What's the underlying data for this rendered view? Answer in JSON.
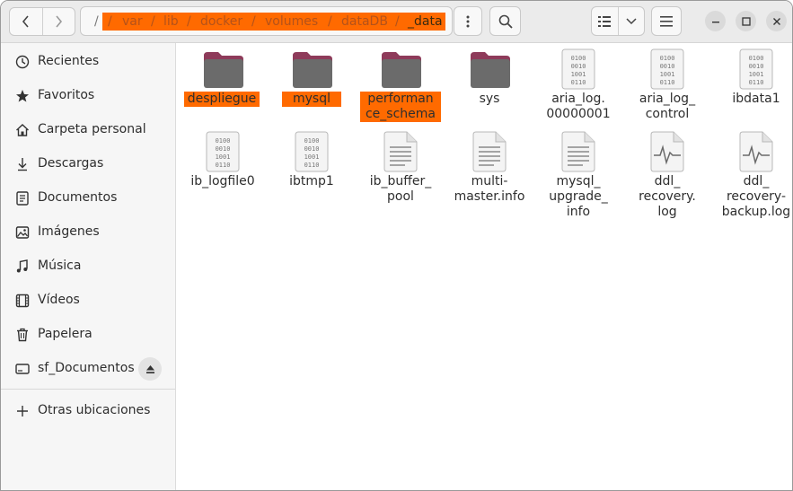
{
  "header": {
    "path_root": "/",
    "path_segments": [
      "/",
      "var",
      "lib",
      "docker",
      "volumes",
      "dataDB",
      "_data"
    ]
  },
  "sidebar": {
    "items": [
      {
        "label": "Recientes",
        "icon": "clock-icon"
      },
      {
        "label": "Favoritos",
        "icon": "star-icon"
      },
      {
        "label": "Carpeta personal",
        "icon": "home-icon"
      },
      {
        "label": "Descargas",
        "icon": "download-icon"
      },
      {
        "label": "Documentos",
        "icon": "document-icon"
      },
      {
        "label": "Imágenes",
        "icon": "image-icon"
      },
      {
        "label": "Música",
        "icon": "music-icon"
      },
      {
        "label": "Vídeos",
        "icon": "video-icon"
      },
      {
        "label": "Papelera",
        "icon": "trash-icon"
      },
      {
        "label": "sf_Documentos",
        "icon": "drive-icon"
      },
      {
        "label": "Otras ubicaciones",
        "icon": "plus-icon"
      }
    ]
  },
  "files": [
    {
      "name1": "despliegue",
      "name2": "",
      "name3": "",
      "type": "folder"
    },
    {
      "name1": "mysql",
      "name2": "",
      "name3": "",
      "type": "folder"
    },
    {
      "name1": "performan",
      "name2": "ce_schema",
      "name3": "",
      "type": "folder"
    },
    {
      "name1": "sys",
      "name2": "",
      "name3": "",
      "type": "folder"
    },
    {
      "name1": "aria_log.",
      "name2": "00000001",
      "name3": "",
      "type": "binary"
    },
    {
      "name1": "aria_log_",
      "name2": "control",
      "name3": "",
      "type": "binary"
    },
    {
      "name1": "ibdata1",
      "name2": "",
      "name3": "",
      "type": "binary"
    },
    {
      "name1": "ib_logfile0",
      "name2": "",
      "name3": "",
      "type": "binary"
    },
    {
      "name1": "ibtmp1",
      "name2": "",
      "name3": "",
      "type": "binary"
    },
    {
      "name1": "ib_buffer_",
      "name2": "pool",
      "name3": "",
      "type": "text"
    },
    {
      "name1": "multi-",
      "name2": "master.info",
      "name3": "",
      "type": "text"
    },
    {
      "name1": "mysql_",
      "name2": "upgrade_",
      "name3": "info",
      "type": "text"
    },
    {
      "name1": "ddl_",
      "name2": "recovery.",
      "name3": "log",
      "type": "log"
    },
    {
      "name1": "ddl_",
      "name2": "recovery-",
      "name3": "backup.log",
      "type": "log"
    }
  ],
  "binary_glyph": "0100\n0010\n1001\n0110",
  "colors": {
    "highlight": "#ff6a00",
    "folder": "#6b6b6b",
    "folder_tab": "#8e3b5a"
  }
}
